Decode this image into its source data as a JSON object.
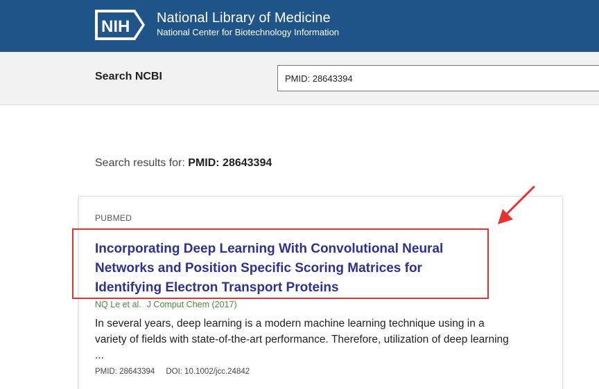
{
  "header": {
    "logo_text": "NIH",
    "title": "National Library of Medicine",
    "subtitle": "National Center for Biotechnology Information",
    "bg_color": "#20558a"
  },
  "search": {
    "label": "Search NCBI",
    "value": "PMID: 28643394"
  },
  "results": {
    "prefix": "Search results for:",
    "query": "PMID: 28643394",
    "items": [
      {
        "source": "PUBMED",
        "title": "Incorporating Deep Learning With Convolutional Neural Networks and Position Specific Scoring Matrices for Identifying Electron Transport Proteins",
        "authors": "NQ Le et al.",
        "journal": "J Comput Chem (2017)",
        "snippet": "In several years, deep learning is a modern machine learning technique using in a variety of fields with state-of-the-art performance. Therefore, utilization of deep learning ...",
        "pmid": "PMID: 28643394",
        "doi": "DOI: 10.1002/jcc.24842"
      }
    ]
  },
  "annotation": {
    "color": "#e8312f",
    "arrow_icon": "arrow-pointer-icon"
  }
}
